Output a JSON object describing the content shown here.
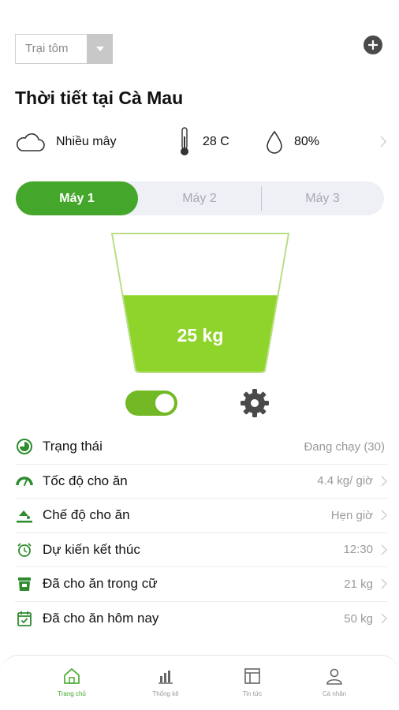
{
  "farm_select": {
    "value": "Trại tôm"
  },
  "weather": {
    "title": "Thời tiết tại Cà Mau",
    "condition": "Nhiều mây",
    "temperature": "28 C",
    "humidity": "80%"
  },
  "machine_tabs": [
    {
      "label": "Máy 1",
      "active": true
    },
    {
      "label": "Máy 2",
      "active": false
    },
    {
      "label": "Máy 3",
      "active": false
    }
  ],
  "feeder": {
    "amount": "25 kg",
    "fill_level": 0.55,
    "enabled": true
  },
  "info_rows": [
    {
      "icon": "status-icon",
      "label": "Trạng thái",
      "value": "Đang chạy (30)"
    },
    {
      "icon": "speedometer-icon",
      "label": "Tốc độ cho ăn",
      "value": "4.4 kg/ giờ"
    },
    {
      "icon": "feed-mode-icon",
      "label": "Chế độ cho ăn",
      "value": "Hẹn giờ"
    },
    {
      "icon": "alarm-clock-icon",
      "label": "Dự kiến kết thúc",
      "value": "12:30"
    },
    {
      "icon": "feed-bin-icon",
      "label": "Đã cho ăn trong cữ",
      "value": "21 kg"
    },
    {
      "icon": "calendar-check-icon",
      "label": "Đã cho ăn hôm nay",
      "value": "50 kg"
    }
  ],
  "bottom_nav": [
    {
      "icon": "home-icon",
      "label": "Trang chủ",
      "active": true
    },
    {
      "icon": "bar-chart-icon",
      "label": "Thống kê",
      "active": false
    },
    {
      "icon": "news-icon",
      "label": "Tin tức",
      "active": false
    },
    {
      "icon": "user-icon",
      "label": "Cá nhân",
      "active": false
    }
  ],
  "colors": {
    "primary_green": "#44a62a",
    "feed_green": "#8fd42a",
    "toggle_green": "#73b825",
    "tab_background": "#eef0f6"
  }
}
